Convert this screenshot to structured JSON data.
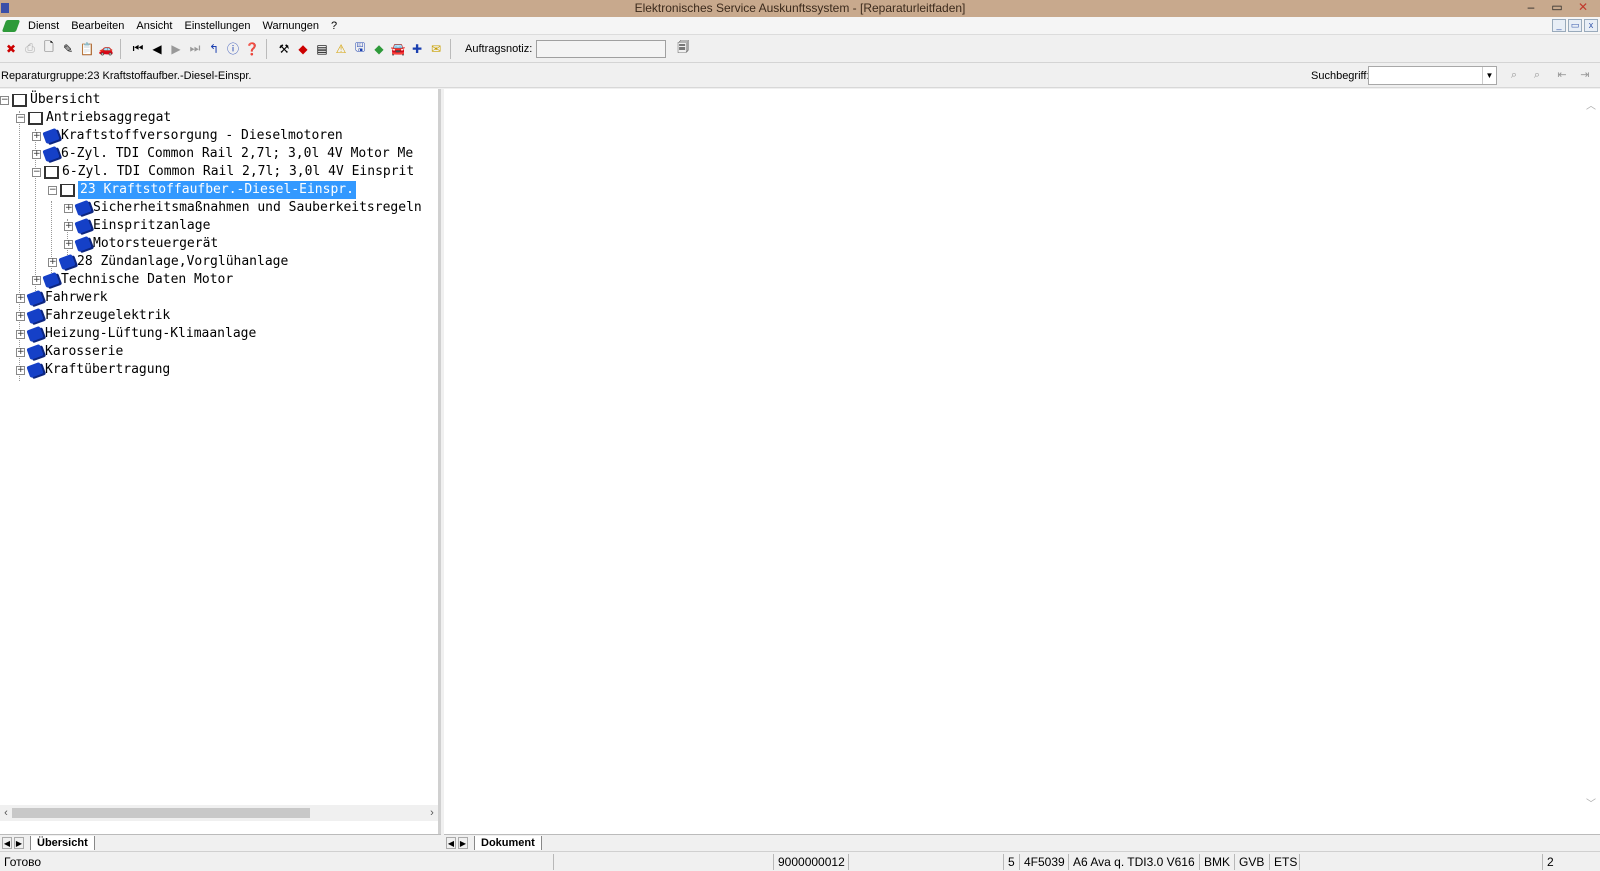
{
  "window": {
    "title": "Elektronisches Service Auskunftssystem - [Reparaturleitfaden]",
    "controls": {
      "minimize": "–",
      "restore": "▭",
      "close": "✕"
    }
  },
  "menu": [
    "Dienst",
    "Bearbeiten",
    "Ansicht",
    "Einstellungen",
    "Warnungen",
    "?"
  ],
  "toolbar": {
    "order_note_label": "Auftragsnotiz:",
    "order_note_value": ""
  },
  "breadcrumb": "Reparaturgruppe:23 Kraftstoffaufber.-Diesel-Einspr.",
  "search": {
    "label": "Suchbegriff:",
    "value": ""
  },
  "tree": [
    {
      "label": "Übersicht",
      "expander": "−",
      "icon": "open-book"
    },
    {
      "label": "Antriebsaggregat",
      "expander": "−",
      "icon": "open-book"
    },
    {
      "label": "Kraftstoffversorgung - Dieselmotoren",
      "expander": "+",
      "icon": "closed-book"
    },
    {
      "label": "6-Zyl. TDI Common Rail 2,7l; 3,0l 4V Motor Me",
      "expander": "+",
      "icon": "closed-book"
    },
    {
      "label": "6-Zyl. TDI Common Rail 2,7l; 3,0l 4V Einsprit",
      "expander": "−",
      "icon": "open-book"
    },
    {
      "label": "23 Kraftstoffaufber.-Diesel-Einspr.",
      "expander": "−",
      "icon": "open-book",
      "selected": true
    },
    {
      "label": "Sicherheitsmaßnahmen und Sauberkeitsregeln",
      "expander": "+",
      "icon": "closed-book"
    },
    {
      "label": "Einspritzanlage",
      "expander": "+",
      "icon": "closed-book"
    },
    {
      "label": "Motorsteuergerät",
      "expander": "+",
      "icon": "closed-book"
    },
    {
      "label": "28 Zündanlage,Vorglühanlage",
      "expander": "+",
      "icon": "closed-book"
    },
    {
      "label": "Technische Daten Motor",
      "expander": "+",
      "icon": "closed-book"
    },
    {
      "label": "Fahrwerk",
      "expander": "+",
      "icon": "closed-book"
    },
    {
      "label": "Fahrzeugelektrik",
      "expander": "+",
      "icon": "closed-book"
    },
    {
      "label": "Heizung-Lüftung-Klimaanlage",
      "expander": "+",
      "icon": "closed-book"
    },
    {
      "label": "Karosserie",
      "expander": "+",
      "icon": "closed-book"
    },
    {
      "label": "Kraftübertragung",
      "expander": "+",
      "icon": "closed-book"
    }
  ],
  "tabs": {
    "left": "Übersicht",
    "right": "Dokument"
  },
  "status": {
    "ready": "Готово",
    "order_number": "9000000012",
    "field_5": "5",
    "vehicle_code": "4F5039",
    "vehicle_desc": "A6 Ava q. TDI3.0 V616",
    "engine": "BMK",
    "gearbox": "GVB",
    "system": "ETS",
    "count": "2"
  },
  "colors": {
    "titlebar": "#c8a98d",
    "selection": "#3399ff",
    "book": "#1540c7"
  }
}
